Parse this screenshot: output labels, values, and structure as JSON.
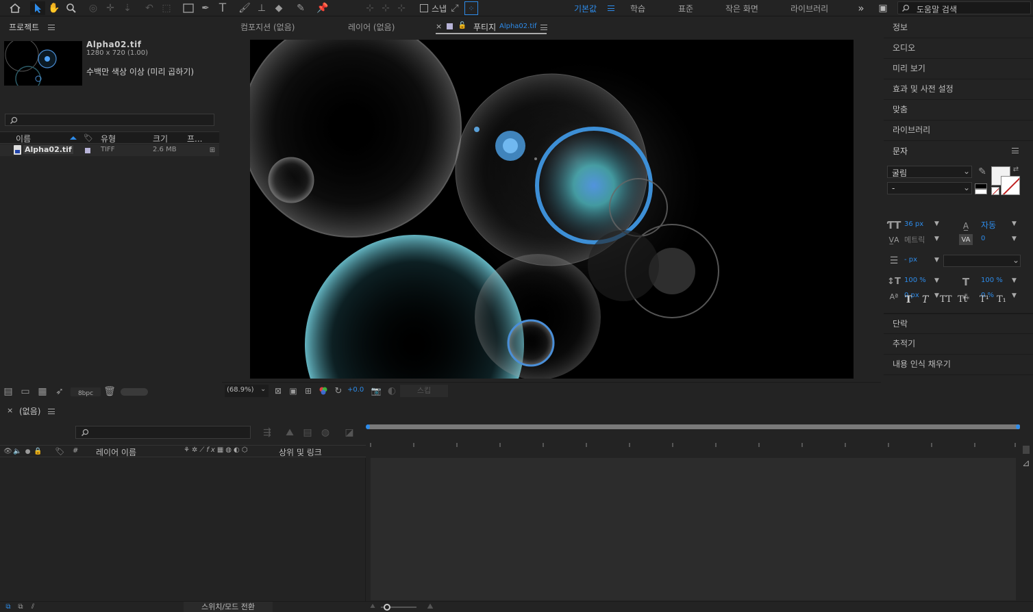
{
  "toolbar": {
    "snap_label": "스냅",
    "workspaces": [
      "기본값",
      "학습",
      "표준",
      "작은 화면",
      "라이브러리"
    ],
    "active_workspace": "기본값",
    "search_placeholder": "도움말 검색"
  },
  "project": {
    "title": "프로젝트",
    "file_name": "Alpha02.tif",
    "file_dims": "1280 x 720 (1.00)",
    "file_desc": "수백만 색상 이상 (미리 곱하기)",
    "search_placeholder": "",
    "columns": [
      "이름",
      "유형",
      "크기",
      "프..."
    ],
    "items": [
      {
        "name": "Alpha02.tif",
        "type": "TIFF",
        "size": "2.6 MB"
      }
    ],
    "bpc": "8bpc"
  },
  "viewer": {
    "tabs": [
      {
        "label": "컴포지션 (없음)"
      },
      {
        "label": "레이어 (없음)"
      },
      {
        "label": "푸티지",
        "sub": "Alpha02.tif"
      }
    ],
    "zoom": "(68.9%)",
    "exposure": "+0.0",
    "mode_label": "스킵"
  },
  "right_panel": {
    "items": [
      "정보",
      "오디오",
      "미리 보기",
      "효과 및 사전 설정",
      "맞춤",
      "라이브러리"
    ],
    "character": {
      "title": "문자",
      "font": "굴림",
      "style": "-",
      "size": "36 px",
      "leading": "자동",
      "kerning": "메트릭",
      "tracking": "0",
      "stroke_width": "- px",
      "vscale": "100 %",
      "hscale": "100 %",
      "baseline": "0 px",
      "tsume": "0 %",
      "style_buttons": [
        "T",
        "T",
        "TT",
        "Tt",
        "T¹",
        "T₁"
      ]
    },
    "bottom_items": [
      "단락",
      "추적기",
      "내용 인식 채우기"
    ]
  },
  "timeline": {
    "tab_label": "(없음)",
    "search_placeholder": "",
    "layer_name_header": "레이어 이름",
    "parent_header": "상위 및 링크",
    "toggle_label": "스위치/모드 전환",
    "hash": "#"
  }
}
